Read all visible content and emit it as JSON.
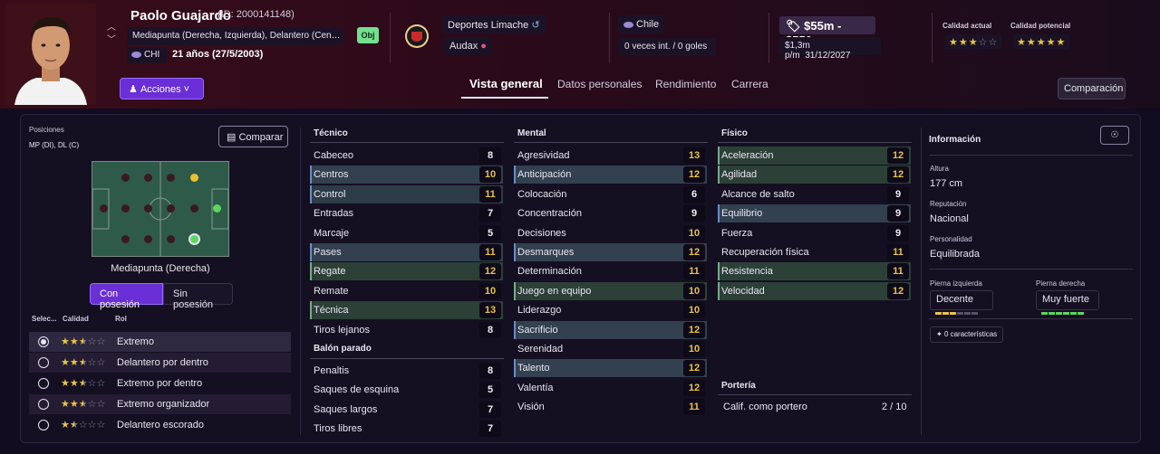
{
  "player": {
    "name": "Paolo Guajardo",
    "id_label": "(ID: 2000141148)",
    "positions_text": "Mediapunta (Derecha, Izquierda), Delantero (Cen…",
    "obj_badge": "Obj",
    "nationality": "CHI",
    "age": "21 años (27/5/2003)",
    "actions_label": "Acciones"
  },
  "club": {
    "club_name": "Deportes Limache",
    "loan_club": "Audax"
  },
  "country": {
    "name": "Chile",
    "caps": "0 veces int. / 0 goles"
  },
  "contract": {
    "value": "$55m - $550m",
    "wage": "$1,3m p/m",
    "expiry": "31/12/2027"
  },
  "quality": {
    "current_label": "Calidad actual",
    "current_stars": 3,
    "potential_label": "Calidad potencial",
    "potential_stars": 5,
    "max_stars": 5
  },
  "tabs": [
    "Vista general",
    "Datos personales",
    "Rendimiento",
    "Carrera"
  ],
  "compare_button": "Comparación",
  "left": {
    "positions_label": "Posiciones",
    "positions_value": "MP (DI), DL (C)",
    "compare_label": "Comparar",
    "role_label": "Mediapunta (Derecha)",
    "seg_on": "Con posesión",
    "seg_off": "Sin posesión",
    "head_select": "Selec...",
    "head_quality": "Calidad",
    "head_role": "Rol",
    "roles": [
      {
        "name": "Extremo",
        "stars": 2.5,
        "selected": true
      },
      {
        "name": "Delantero por dentro",
        "stars": 2.5,
        "selected": false
      },
      {
        "name": "Extremo por dentro",
        "stars": 2.5,
        "selected": false
      },
      {
        "name": "Extremo organizador",
        "stars": 2.5,
        "selected": false
      },
      {
        "name": "Delantero escorado",
        "stars": 1.5,
        "selected": false
      }
    ]
  },
  "tecnico": {
    "title": "Técnico",
    "attrs": [
      {
        "name": "Cabeceo",
        "value": "8"
      },
      {
        "name": "Centros",
        "value": "10"
      },
      {
        "name": "Control",
        "value": "11"
      },
      {
        "name": "Entradas",
        "value": "7"
      },
      {
        "name": "Marcaje",
        "value": "5"
      },
      {
        "name": "Pases",
        "value": "11"
      },
      {
        "name": "Regate",
        "value": "12"
      },
      {
        "name": "Remate",
        "value": "10"
      },
      {
        "name": "Técnica",
        "value": "13"
      },
      {
        "name": "Tiros lejanos",
        "value": "8"
      }
    ]
  },
  "balon_parado": {
    "title": "Balón parado",
    "attrs": [
      {
        "name": "Penaltis",
        "value": "8"
      },
      {
        "name": "Saques de esquina",
        "value": "5"
      },
      {
        "name": "Saques largos",
        "value": "7"
      },
      {
        "name": "Tiros libres",
        "value": "7"
      }
    ]
  },
  "mental": {
    "title": "Mental",
    "attrs": [
      {
        "name": "Agresividad",
        "value": "13"
      },
      {
        "name": "Anticipación",
        "value": "12"
      },
      {
        "name": "Colocación",
        "value": "6"
      },
      {
        "name": "Concentración",
        "value": "9"
      },
      {
        "name": "Decisiones",
        "value": "10"
      },
      {
        "name": "Desmarques",
        "value": "12"
      },
      {
        "name": "Determinación",
        "value": "11"
      },
      {
        "name": "Juego en equipo",
        "value": "10"
      },
      {
        "name": "Liderazgo",
        "value": "10"
      },
      {
        "name": "Sacrificio",
        "value": "12"
      },
      {
        "name": "Serenidad",
        "value": "10"
      },
      {
        "name": "Talento",
        "value": "12"
      },
      {
        "name": "Valentía",
        "value": "12"
      },
      {
        "name": "Visión",
        "value": "11"
      }
    ]
  },
  "fisico": {
    "title": "Físico",
    "attrs": [
      {
        "name": "Aceleración",
        "value": "12"
      },
      {
        "name": "Agilidad",
        "value": "12"
      },
      {
        "name": "Alcance de salto",
        "value": "9"
      },
      {
        "name": "Equilibrio",
        "value": "9"
      },
      {
        "name": "Fuerza",
        "value": "9"
      },
      {
        "name": "Recuperación física",
        "value": "11"
      },
      {
        "name": "Resistencia",
        "value": "11"
      },
      {
        "name": "Velocidad",
        "value": "12"
      }
    ]
  },
  "porteria": {
    "title": "Portería",
    "label": "Calif. como portero",
    "value": "2 / 10"
  },
  "info": {
    "title": "Información",
    "height_label": "Altura",
    "height": "177 cm",
    "reputation_label": "Reputación",
    "reputation": "Nacional",
    "personality_label": "Personalidad",
    "personality": "Equilibrada",
    "left_foot_label": "Pierna izquierda",
    "left_foot": "Decente",
    "left_foot_level": 3,
    "right_foot_label": "Pierna derecha",
    "right_foot": "Muy fuerte",
    "right_foot_level": 6,
    "foot_level_max": 6,
    "traits": "0 características"
  },
  "colors": {
    "accent": "#6a2fd6",
    "star": "#e8c446",
    "highlight_value": "#e8c446",
    "left_foot_bar": "#e8c446",
    "right_foot_bar": "#5ad85a"
  }
}
